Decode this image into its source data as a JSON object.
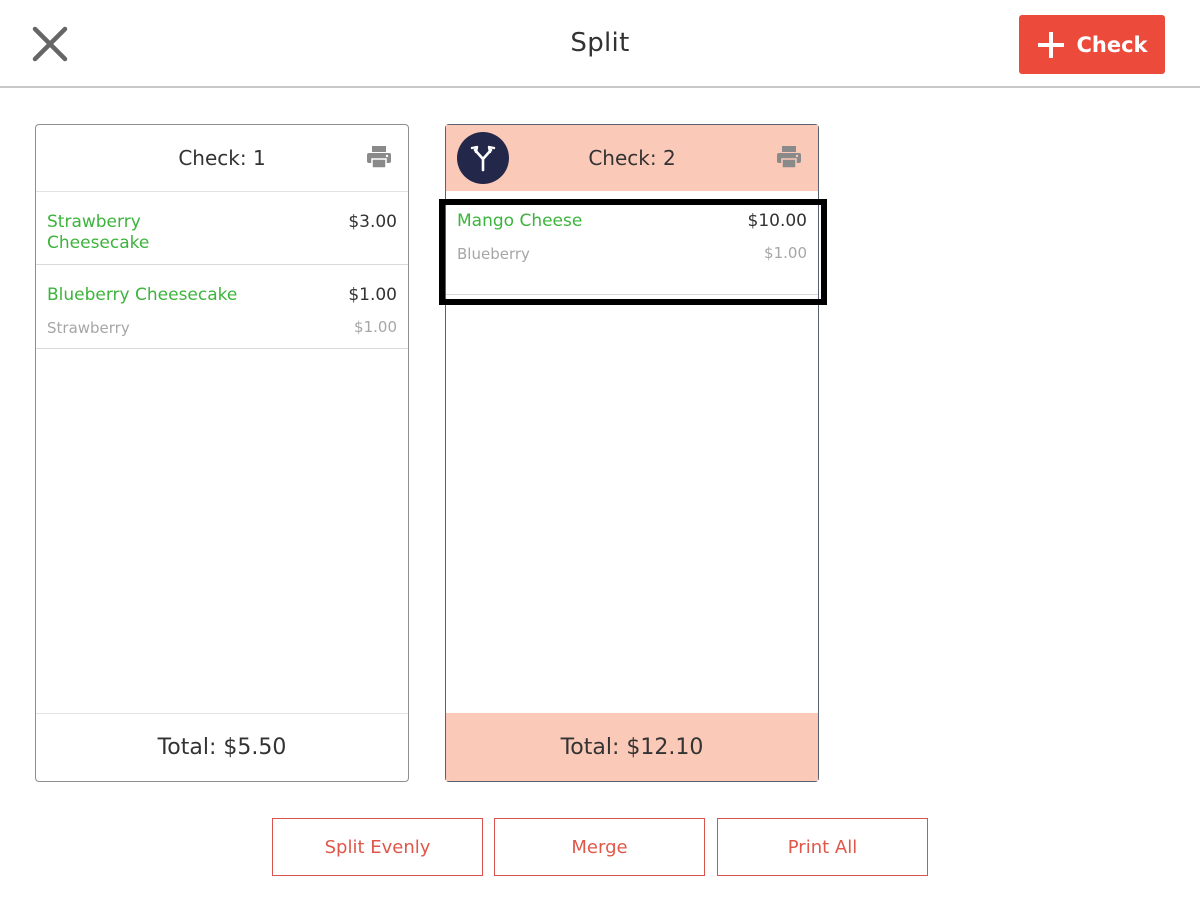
{
  "header": {
    "title": "Split",
    "add_check_label": "Check"
  },
  "checks": [
    {
      "title": "Check: 1",
      "items": [
        {
          "name": "Strawberry Cheesecake",
          "price": "$3.00",
          "modifiers": []
        },
        {
          "name": "Blueberry Cheesecake",
          "price": "$1.00",
          "modifiers": [
            {
              "name": "Strawberry",
              "price": "$1.00"
            }
          ]
        }
      ],
      "total": "Total: $5.50"
    },
    {
      "title": "Check: 2",
      "items": [
        {
          "name": "Mango Cheese",
          "price": "$10.00",
          "modifiers": [
            {
              "name": "Blueberry",
              "price": "$1.00"
            }
          ]
        }
      ],
      "total": "Total: $12.10"
    }
  ],
  "actions": {
    "split_evenly": "Split Evenly",
    "merge": "Merge",
    "print_all": "Print All"
  },
  "colors": {
    "accent": "#ec4b3c",
    "item_green": "#3cb43c",
    "active_check_bg": "#fbc9b8",
    "split_icon_bg": "#23284a"
  },
  "icons": {
    "close": "close-icon",
    "plus": "plus-icon",
    "printer": "printer-icon",
    "split": "split-arrows-icon"
  }
}
